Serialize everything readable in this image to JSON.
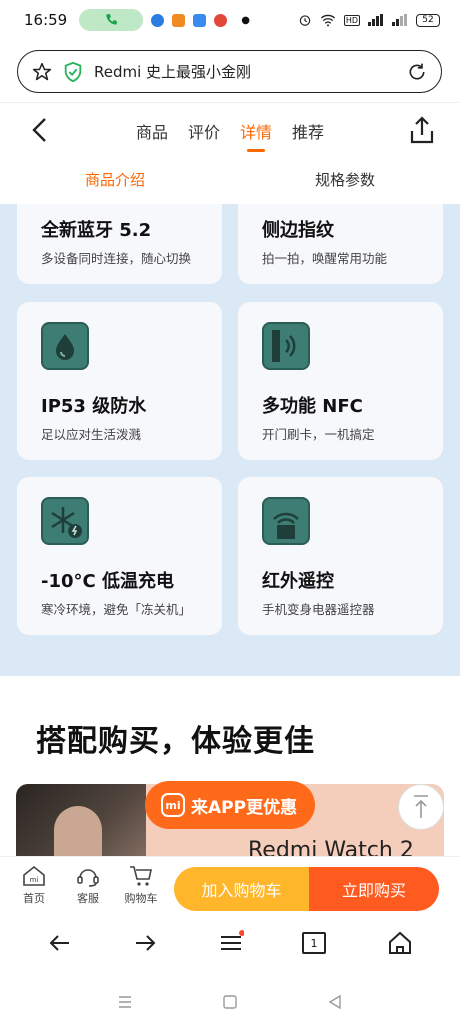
{
  "status_bar": {
    "time": "16:59",
    "battery": "52"
  },
  "url_bar": {
    "text": "Redmi 史上最强小金刚"
  },
  "nav": {
    "tabs": [
      {
        "label": "商品"
      },
      {
        "label": "评价"
      },
      {
        "label": "详情"
      },
      {
        "label": "推荐"
      }
    ],
    "active_tab": "详情"
  },
  "sub_tabs": {
    "intro": "商品介绍",
    "specs": "规格参数"
  },
  "features": [
    {
      "title": "全新蓝牙 5.2",
      "desc": "多设备同时连接，随心切换",
      "icon": "bluetooth-icon"
    },
    {
      "title": "侧边指纹",
      "desc": "拍一拍，唤醒常用功能",
      "icon": "fingerprint-icon"
    },
    {
      "title": "IP53 级防水",
      "desc": "足以应对生活泼溅",
      "icon": "water-drop-icon"
    },
    {
      "title": "多功能 NFC",
      "desc": "开门刷卡，一机搞定",
      "icon": "nfc-icon"
    },
    {
      "title": "-10°C 低温充电",
      "desc": "寒冷环境，避免「冻关机」",
      "icon": "snowflake-charge-icon"
    },
    {
      "title": "红外遥控",
      "desc": "手机变身电器遥控器",
      "icon": "infrared-remote-icon"
    }
  ],
  "section_title": "搭配购买，体验更佳",
  "promo": {
    "product": "Redmi Watch 2",
    "app_pill": "来APP更优惠",
    "mi_logo": "mi"
  },
  "buy_bar": {
    "home": "首页",
    "service": "客服",
    "cart": "购物车",
    "add_to_cart": "加入购物车",
    "buy_now": "立即购买"
  },
  "browser_bar": {
    "tab_count": "1"
  },
  "colors": {
    "accent": "#ff6700",
    "content_bg": "#dbe8f5",
    "icon_teal": "#3d7d73",
    "cart_btn": "#ffb62a",
    "buy_btn": "#ff5a1f"
  }
}
